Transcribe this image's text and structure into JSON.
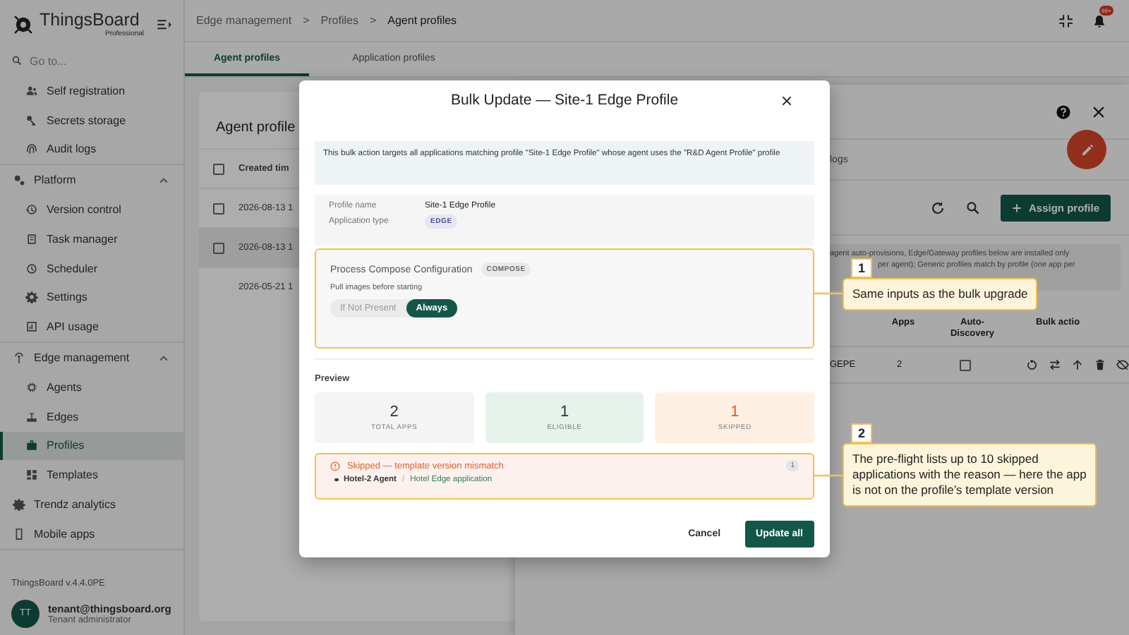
{
  "sidebar": {
    "logo": {
      "name": "ThingsBoard",
      "edition": "Professional"
    },
    "search": {
      "placeholder": "Go to..."
    },
    "items": [
      {
        "label": "Self registration",
        "kind": "child",
        "selected": false
      },
      {
        "label": "Secrets storage",
        "kind": "child",
        "selected": false
      },
      {
        "label": "Audit logs",
        "kind": "child",
        "selected": false
      },
      {
        "label": "Platform",
        "kind": "section",
        "expanded": true,
        "selected": false
      },
      {
        "label": "Version control",
        "kind": "child",
        "selected": false
      },
      {
        "label": "Task manager",
        "kind": "child",
        "selected": false
      },
      {
        "label": "Scheduler",
        "kind": "child",
        "selected": false
      },
      {
        "label": "Settings",
        "kind": "child",
        "selected": false
      },
      {
        "label": "API usage",
        "kind": "child",
        "selected": false
      },
      {
        "label": "Edge management",
        "kind": "section",
        "expanded": true,
        "selected": false
      },
      {
        "label": "Agents",
        "kind": "child",
        "selected": false
      },
      {
        "label": "Edges",
        "kind": "child",
        "selected": false
      },
      {
        "label": "Profiles",
        "kind": "child",
        "selected": true
      },
      {
        "label": "Templates",
        "kind": "child",
        "selected": false
      },
      {
        "label": "Trendz analytics",
        "kind": "top",
        "selected": false
      },
      {
        "label": "Mobile apps",
        "kind": "top",
        "selected": false
      }
    ],
    "version": "ThingsBoard v.4.4.0PE",
    "user": {
      "initials": "TT",
      "email": "tenant@thingsboard.org",
      "role": "Tenant administrator"
    }
  },
  "header": {
    "breadcrumb": [
      "Edge management",
      ">",
      "Profiles",
      ">",
      "Agent profiles"
    ],
    "notification_badge": "99+"
  },
  "tabs": [
    {
      "label": "Agent profiles",
      "selected": true
    },
    {
      "label": "Application profiles",
      "selected": false
    }
  ],
  "list_panel": {
    "title": "Agent profile",
    "all_checked": false,
    "columns": [
      "Created tim"
    ],
    "rows": [
      {
        "cell": "2026-08-13 1",
        "kind": "selectable",
        "checked": false,
        "selected": false
      },
      {
        "cell": "2026-08-13 1",
        "kind": "selectable",
        "checked": false,
        "selected": true
      },
      {
        "cell": "2026-05-21 1",
        "kind": "plain",
        "selected": false
      }
    ]
  },
  "drawer": {
    "tab": "logs",
    "assign_button": "Assign profile",
    "info_lines": [
      "agent auto-provisions, Edge/Gateway profiles below are installed only",
      "per agent); Generic profiles match by profile (one app per"
    ],
    "columns": [
      "Apps",
      "Auto-Discovery",
      "Bulk actio"
    ],
    "row": {
      "cell_1": "GEPE",
      "apps": "2",
      "auto_discovery": false
    }
  },
  "dialog": {
    "title": "Bulk Update — Site-1 Edge Profile",
    "info": "This bulk action targets all applications matching profile \"Site-1 Edge Profile\" whose agent uses the \"R&D Agent Profile\" profile",
    "profile": [
      {
        "label": "Profile name",
        "value": "Site-1 Edge Profile",
        "kind": "text"
      },
      {
        "label": "Application type",
        "value": "EDGE",
        "kind": "chip"
      }
    ],
    "config": {
      "title": "Process Compose Configuration",
      "chip": "COMPOSE",
      "field_label": "Pull images before starting",
      "options": [
        {
          "label": "If Not Present",
          "selected": false
        },
        {
          "label": "Always",
          "selected": true
        }
      ]
    },
    "preview_label": "Preview",
    "stats": [
      {
        "value": "2",
        "label": "TOTAL APPS",
        "kind": "total"
      },
      {
        "value": "1",
        "label": "ELIGIBLE",
        "kind": "eligible"
      },
      {
        "value": "1",
        "label": "SKIPPED",
        "kind": "skipped"
      }
    ],
    "skipped": {
      "title": "Skipped — template version mismatch",
      "count": "1",
      "items": [
        {
          "agent": "Hotel-2 Agent",
          "separator": "/",
          "application": "Hotel Edge application"
        }
      ]
    },
    "buttons": [
      {
        "label": "Cancel",
        "kind": "text"
      },
      {
        "label": "Update all",
        "kind": "primary"
      }
    ]
  },
  "annotations": [
    {
      "number": "1",
      "text": "Same inputs as the bulk upgrade"
    },
    {
      "number": "2",
      "text": "The pre-flight lists up to 10 skipped applications with the reason — here the app is not on the profile’s template version"
    }
  ]
}
